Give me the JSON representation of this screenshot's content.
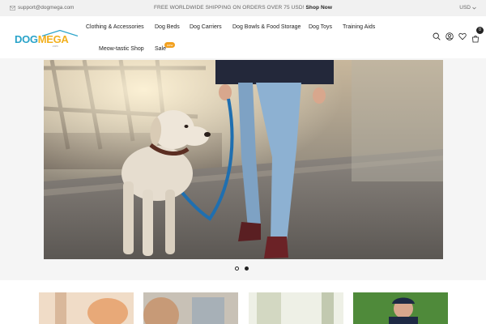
{
  "topbar": {
    "email": "support@dogmega.com",
    "promo_text": "FREE WORLDWIDE SHIPPING ON ORDERS OVER 75 USD!",
    "promo_link": "Shop Now",
    "currency": "USD"
  },
  "logo": {
    "text_a": "DOG",
    "text_b": "MEGA",
    "sub": ".com"
  },
  "nav": {
    "items": [
      "Clothing & Accessories",
      "Dog Beds",
      "Dog Carriers",
      "Dog Bowls & Food Storage",
      "Dog Toys",
      "Training Aids",
      "Meow-tastic Shop",
      "Sale"
    ],
    "sale_badge": "new"
  },
  "header_icons": [
    "search-icon",
    "account-icon",
    "wishlist-icon",
    "cart-icon"
  ],
  "cart_count": "0",
  "colors": {
    "brand_blue": "#29a3c9",
    "brand_yellow": "#f2b01e",
    "badge": "#f2a01e"
  },
  "slider": {
    "total_slides": 2,
    "active_slide": 1
  }
}
